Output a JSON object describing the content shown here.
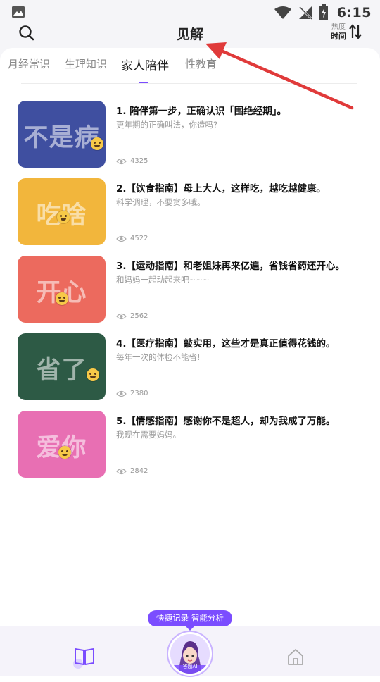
{
  "status_bar": {
    "time": "6:15",
    "icons": [
      "gallery-icon",
      "wifi-icon",
      "no-signal-icon",
      "battery-charging-icon"
    ]
  },
  "header": {
    "title": "见解",
    "search_icon": "search-icon",
    "sort_label_top": "热度",
    "sort_label_bottom": "时间",
    "sort_icon": "sort-arrows-icon"
  },
  "tabs": [
    {
      "label": "月经常识",
      "active": false
    },
    {
      "label": "生理知识",
      "active": false
    },
    {
      "label": "家人陪伴",
      "active": true
    },
    {
      "label": "性教育",
      "active": false
    }
  ],
  "articles": [
    {
      "thumb_text": "不是病",
      "thumb_color": "#3f4fa0",
      "title": "1. 陪伴第一步，正确认识「围绝经期」。",
      "subtitle": "更年期的正确叫法，你造吗?",
      "views": "4325"
    },
    {
      "thumb_text": "吃啥",
      "thumb_color": "#f2b63c",
      "title": "2.【饮食指南】母上大人，这样吃，越吃越健康。",
      "subtitle": "科学调理，不要贪多哦。",
      "views": "4522"
    },
    {
      "thumb_text": "开心",
      "thumb_color": "#ec6a5e",
      "title": "3.【运动指南】和老姐妹再来亿遍，省钱省药还开心。",
      "subtitle": "和妈妈一起动起来吧~~~",
      "views": "2562"
    },
    {
      "thumb_text": "省了",
      "thumb_color": "#2d5a45",
      "title": "4.【医疗指南】敲实用，这些才是真正值得花钱的。",
      "subtitle": "每年一次的体检不能省!",
      "views": "2380"
    },
    {
      "thumb_text": "爱你",
      "thumb_color": "#e86fb3",
      "title": "5.【情感指南】感谢你不是超人，却为我成了万能。",
      "subtitle": "我现在需要妈妈。",
      "views": "2842"
    }
  ],
  "bottom_nav": {
    "left_icon": "book-icon",
    "right_icon": "home-icon",
    "tooltip": "快捷记录 智能分析",
    "ai_label": "答题AI"
  },
  "colors": {
    "accent": "#7b4dff",
    "annotation_arrow": "#e03a3a"
  }
}
